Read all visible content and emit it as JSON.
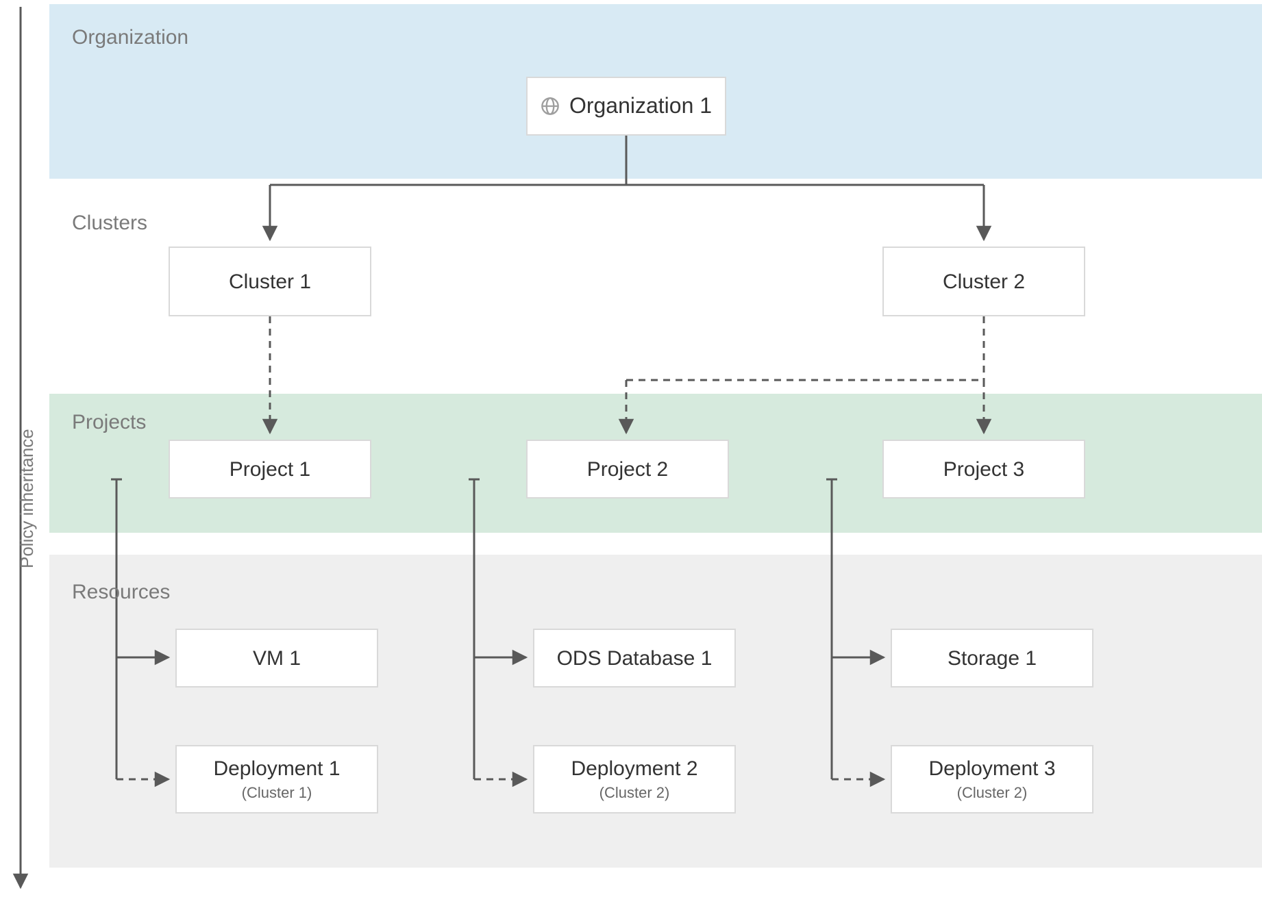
{
  "axis_label": "Policy inheritance",
  "sections": {
    "organization": "Organization",
    "clusters": "Clusters",
    "projects": "Projects",
    "resources": "Resources"
  },
  "nodes": {
    "org1": "Organization 1",
    "cluster1": "Cluster 1",
    "cluster2": "Cluster 2",
    "project1": "Project 1",
    "project2": "Project 2",
    "project3": "Project 3",
    "vm1": "VM 1",
    "ods_db1": "ODS Database 1",
    "storage1": "Storage 1",
    "deployment1": {
      "title": "Deployment 1",
      "sub": "(Cluster 1)"
    },
    "deployment2": {
      "title": "Deployment 2",
      "sub": "(Cluster 2)"
    },
    "deployment3": {
      "title": "Deployment 3",
      "sub": "(Cluster 2)"
    }
  }
}
